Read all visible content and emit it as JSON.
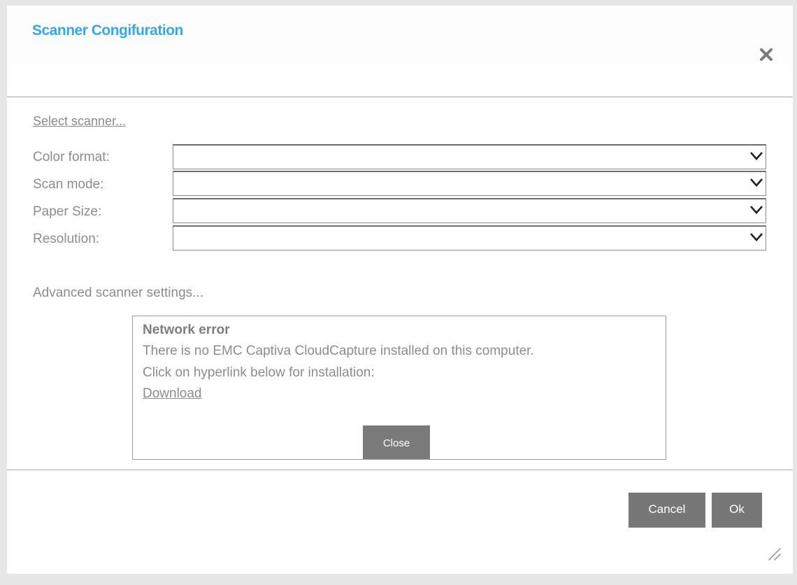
{
  "dialog": {
    "title": "Scanner Congifuration",
    "close_icon": "close-x-icon",
    "select_scanner_link": "Select scanner...",
    "advanced_settings_link": "Advanced scanner settings...",
    "resize_icon": "resize-grip-icon"
  },
  "fields": [
    {
      "label": "Color format:",
      "value": ""
    },
    {
      "label": "Scan mode:",
      "value": ""
    },
    {
      "label": "Paper Size:",
      "value": ""
    },
    {
      "label": "Resolution:",
      "value": ""
    }
  ],
  "error": {
    "title": "Network error",
    "line1": "There is no EMC Captiva CloudCapture installed on this computer.",
    "line2": "Click on hyperlink below for installation:",
    "link": "Download",
    "close_label": "Close"
  },
  "footer": {
    "cancel_label": "Cancel",
    "ok_label": "Ok"
  },
  "colors": {
    "title": "#3aa6df",
    "button_bg": "#777777",
    "text_gray": "#8c8c8c",
    "page_bg": "#e6e6e6"
  }
}
